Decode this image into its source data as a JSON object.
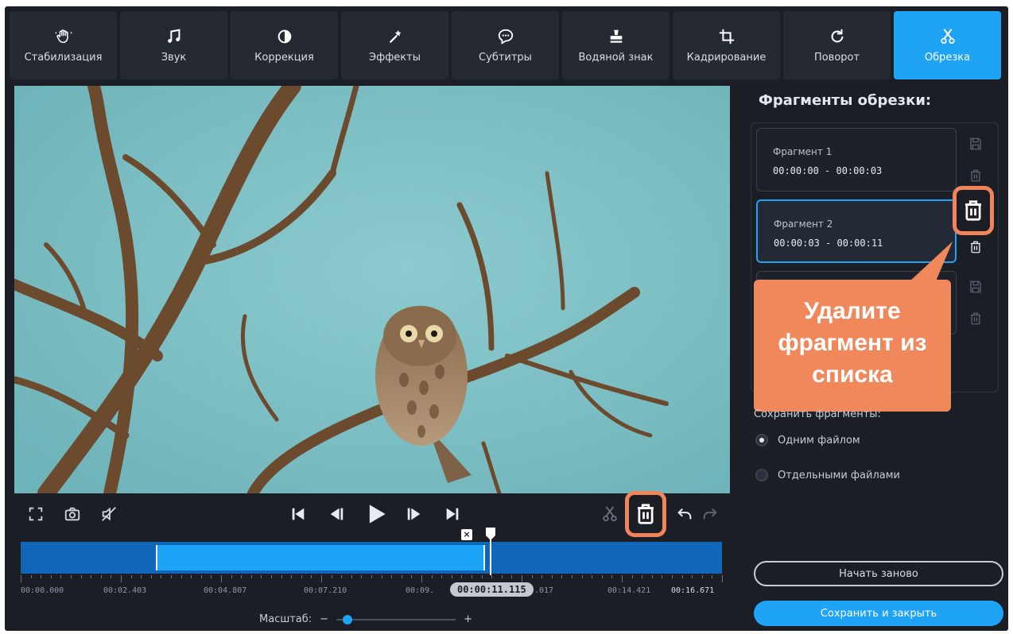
{
  "toolbar": {
    "tools": [
      {
        "label": "Стабилизация",
        "icon": "hand-icon"
      },
      {
        "label": "Звук",
        "icon": "music-note-icon"
      },
      {
        "label": "Коррекция",
        "icon": "contrast-icon"
      },
      {
        "label": "Эффекты",
        "icon": "magic-wand-icon"
      },
      {
        "label": "Субтитры",
        "icon": "speech-bubble-icon"
      },
      {
        "label": "Водяной знак",
        "icon": "stamp-icon"
      },
      {
        "label": "Кадрирование",
        "icon": "crop-icon"
      },
      {
        "label": "Поворот",
        "icon": "rotate-icon"
      },
      {
        "label": "Обрезка",
        "icon": "scissors-icon"
      }
    ],
    "active": "Обрезка",
    "accent": "#1fa3f5"
  },
  "panel": {
    "title": "Фрагменты обрезки:",
    "fragments": [
      {
        "name": "Фрагмент 1",
        "time": "00:00:00 - 00:00:03",
        "selected": false
      },
      {
        "name": "Фрагмент 2",
        "time": "00:00:03 - 00:00:11",
        "selected": true
      }
    ],
    "save_fragments_label": "Сохранить фрагменты:",
    "options": [
      {
        "label": "Одним файлом",
        "checked": true
      },
      {
        "label": "Отдельными файлами",
        "checked": false
      }
    ],
    "restart_label": "Начать заново",
    "save_close_label": "Сохранить и закрыть"
  },
  "callout": {
    "line1": "Удалите",
    "line2": "фрагмент из",
    "line3": "списка",
    "color": "#f0885c"
  },
  "timeline": {
    "labels": [
      "00:00.000",
      "00:02.403",
      "00:04.807",
      "00:07.210",
      "00:09.",
      ".017",
      "00:14.421",
      "00:16.671"
    ],
    "current_time": "00:00:11.115",
    "selection_start_fraction": 0.19,
    "selection_end_fraction": 0.66
  },
  "zoom": {
    "label": "Масштаб:",
    "minus": "−",
    "plus": "+",
    "level_fraction": 0.05
  }
}
